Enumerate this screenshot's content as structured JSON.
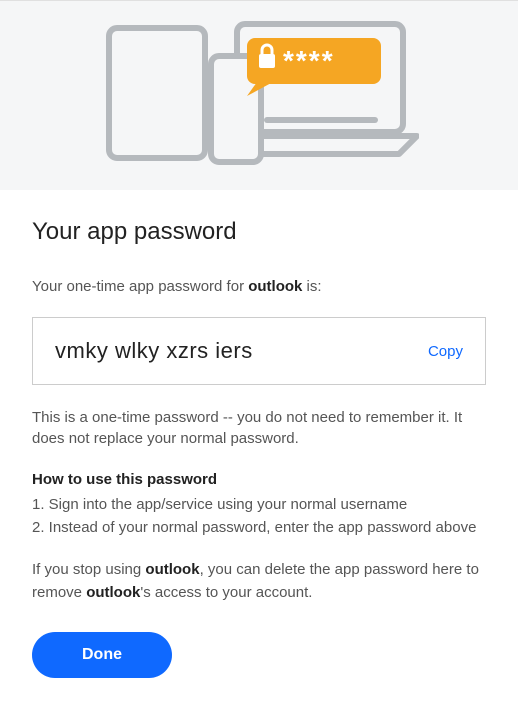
{
  "hero": {
    "icon_name": "devices-lock-illustration"
  },
  "title": "Your app password",
  "intro": {
    "prefix": "Your one-time app password for ",
    "app_name": "outlook",
    "suffix": " is:"
  },
  "password": {
    "value": "vmky wlky xzrs iers",
    "copy_label": "Copy"
  },
  "note": "This is a one-time password -- you do not need to remember it. It does not replace your normal password.",
  "how": {
    "heading": "How to use this password",
    "step1": "1. Sign into the app/service using your normal username",
    "step2": "2. Instead of your normal password, enter the app password above"
  },
  "stop": {
    "prefix": "If you stop using ",
    "app1": "outlook",
    "mid": ", you can delete the app password here to remove ",
    "app2": "outlook",
    "suffix": "'s access to your account."
  },
  "done_label": "Done"
}
